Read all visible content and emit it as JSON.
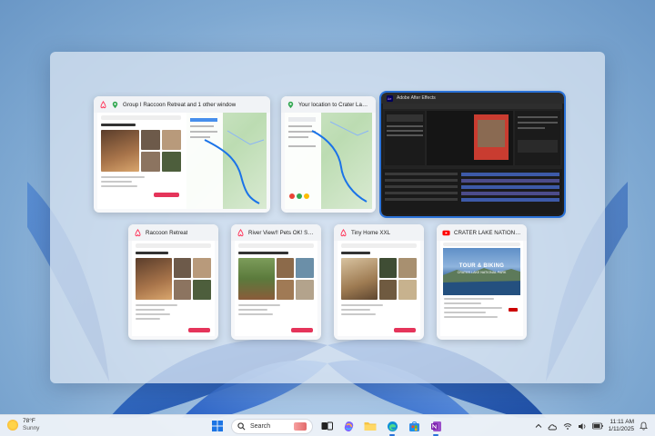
{
  "windows": [
    {
      "id": "w1",
      "title": "Group I Raccoon Retreat and 1 other window",
      "app": "airbnb"
    },
    {
      "id": "w2",
      "title": "Your location to Crater Lake...",
      "app": "maps"
    },
    {
      "id": "w3",
      "title": "Adobe After Effects",
      "app": "aftereffects"
    },
    {
      "id": "w4",
      "title": "Raccoon Retreat",
      "app": "airbnb"
    },
    {
      "id": "w5",
      "title": "River View!! Pets OK! Short...",
      "app": "airbnb"
    },
    {
      "id": "w6",
      "title": "Tiny Home XXL",
      "app": "airbnb"
    },
    {
      "id": "w7",
      "title": "CRATER LAKE NATIONAL P...",
      "app": "youtube"
    }
  ],
  "youtube_thumb": {
    "line1": "TOUR & BIKING",
    "line2": "CRATER LAKE NATIONAL PARK"
  },
  "taskbar": {
    "weather_temp": "78°F",
    "weather_desc": "Sunny",
    "search_label": "Search",
    "time": "11:11 AM",
    "date": "1/11/2025"
  },
  "colors": {
    "accent": "#2a72d8",
    "airbnb": "#ff385c",
    "youtube": "#ff0000"
  }
}
